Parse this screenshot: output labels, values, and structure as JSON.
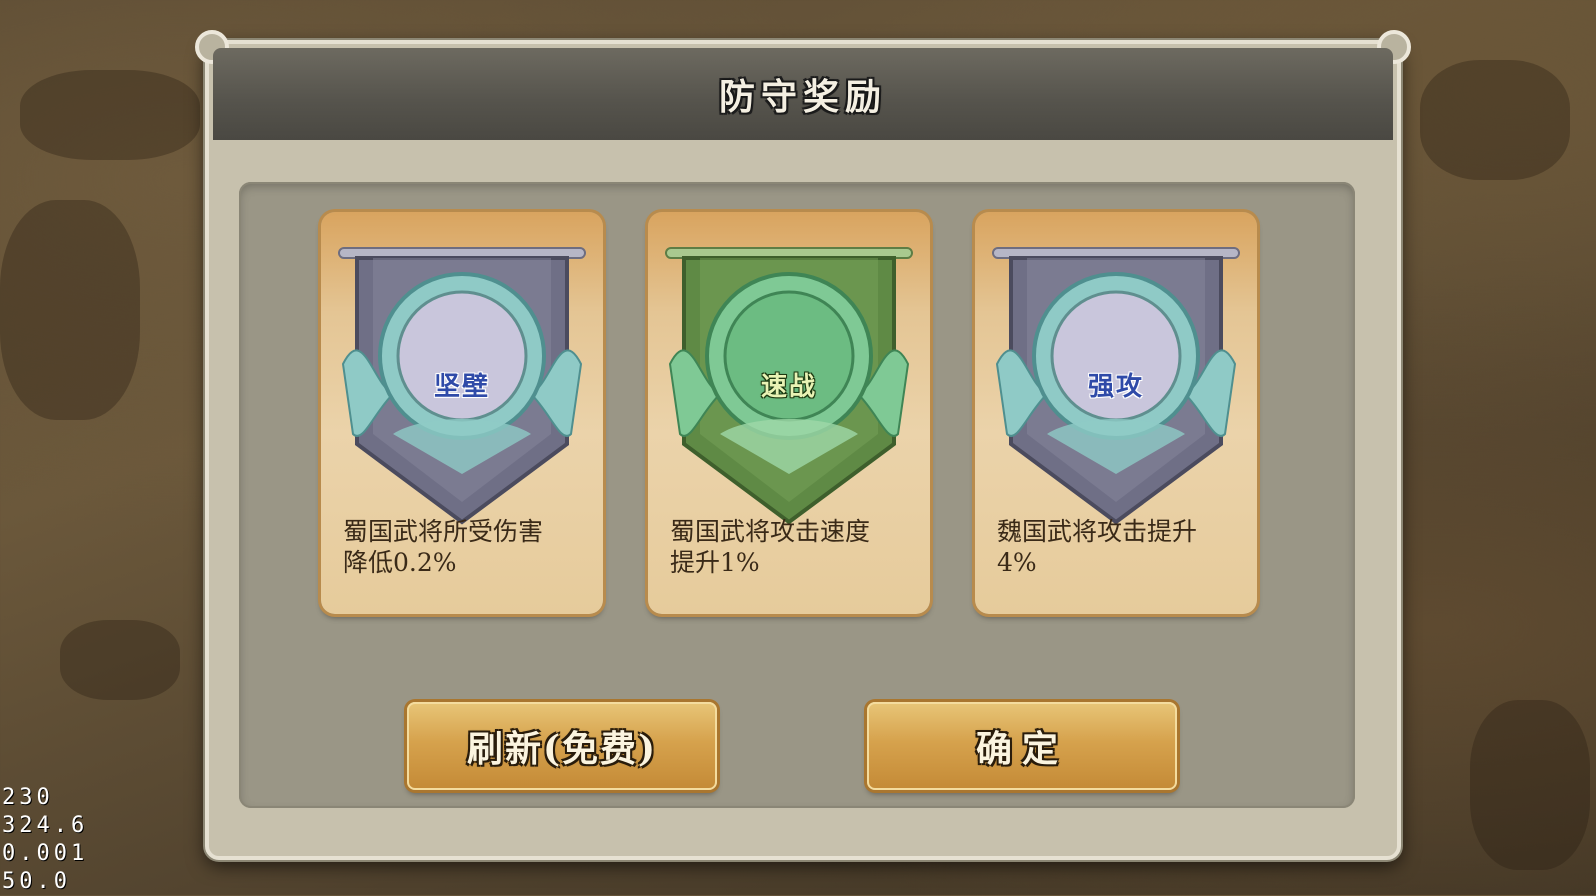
{
  "dialog": {
    "title": "防守奖励"
  },
  "cards": [
    {
      "emblem": "坚壁",
      "description_line1": "蜀国武将所受伤害",
      "description_line2": "降低0.2%",
      "theme": "blue",
      "banner_color": "#6f6f86",
      "ring_color": "#8fcac6"
    },
    {
      "emblem": "速战",
      "description_line1": "蜀国武将攻击速度",
      "description_line2": "提升1%",
      "theme": "green",
      "banner_color": "#5f8a45",
      "ring_color": "#7fc995"
    },
    {
      "emblem": "强攻",
      "description_line1": "魏国武将攻击提升",
      "description_line2": "4%",
      "theme": "blue",
      "banner_color": "#6f6f86",
      "ring_color": "#8fcac6"
    }
  ],
  "buttons": {
    "refresh_label": "刷新(免费)",
    "confirm_label": "确定"
  },
  "debug_stats": [
    "230",
    "324.6",
    "0.001",
    "50.0"
  ]
}
